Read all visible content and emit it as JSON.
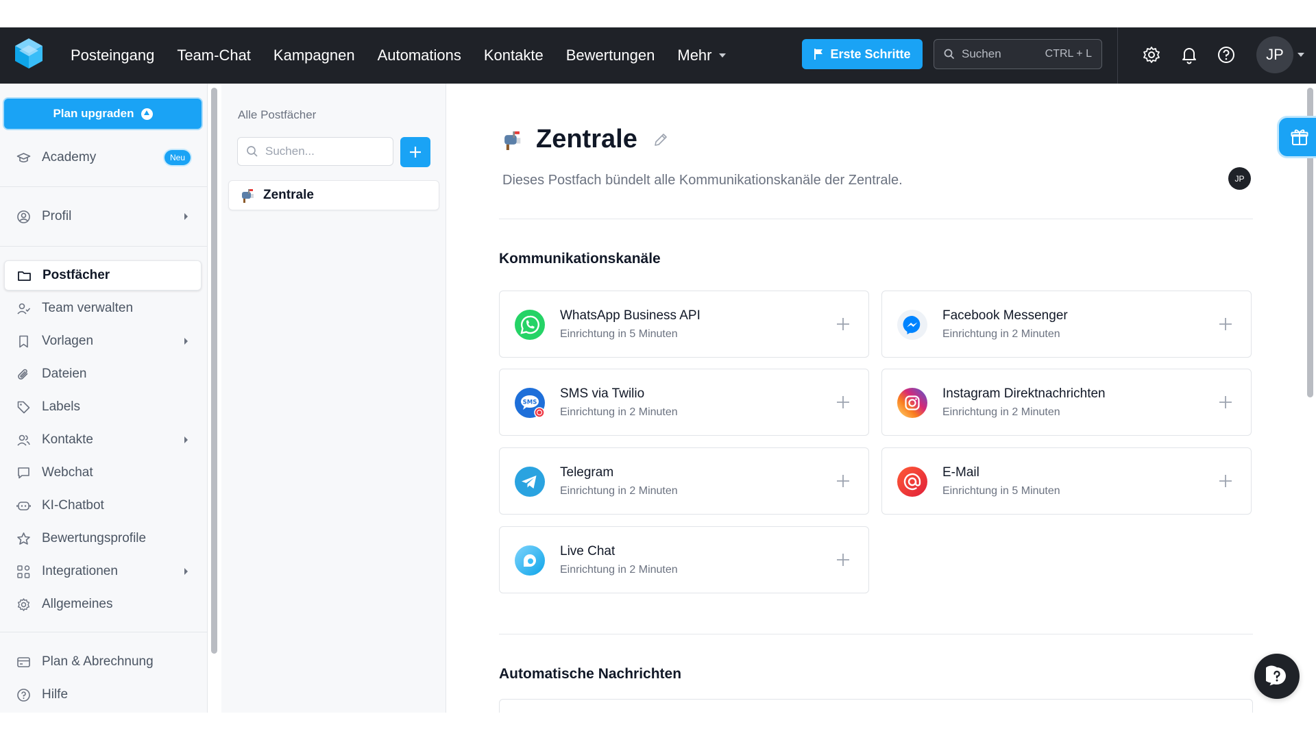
{
  "navbar": {
    "links": [
      "Posteingang",
      "Team-Chat",
      "Kampagnen",
      "Automations",
      "Kontakte",
      "Bewertungen"
    ],
    "more_label": "Mehr",
    "first_steps_label": "Erste Schritte",
    "search_placeholder": "Suchen",
    "search_shortcut": "CTRL + L",
    "avatar_initials": "JP",
    "icons": [
      "settings-icon",
      "bell-icon",
      "help-icon"
    ]
  },
  "sidebar": {
    "upgrade_label": "Plan upgraden",
    "items": [
      {
        "label": "Academy",
        "icon": "graduation-cap-icon",
        "badge": "Neu"
      },
      {
        "label": "Profil",
        "icon": "user-circle-icon",
        "has_submenu": true
      },
      {
        "label": "Postfächer",
        "icon": "folder-icon",
        "active": true
      },
      {
        "label": "Team verwalten",
        "icon": "user-check-icon"
      },
      {
        "label": "Vorlagen",
        "icon": "bookmark-icon",
        "has_submenu": true
      },
      {
        "label": "Dateien",
        "icon": "paperclip-icon"
      },
      {
        "label": "Labels",
        "icon": "tag-icon"
      },
      {
        "label": "Kontakte",
        "icon": "users-icon",
        "has_submenu": true
      },
      {
        "label": "Webchat",
        "icon": "chat-bubble-icon"
      },
      {
        "label": "KI-Chatbot",
        "icon": "bot-icon"
      },
      {
        "label": "Bewertungsprofile",
        "icon": "star-icon"
      },
      {
        "label": "Integrationen",
        "icon": "integrations-icon",
        "has_submenu": true
      },
      {
        "label": "Allgemeines",
        "icon": "gear-icon"
      },
      {
        "label": "Plan & Abrechnung",
        "icon": "credit-card-icon"
      },
      {
        "label": "Hilfe",
        "icon": "help-circle-icon"
      }
    ]
  },
  "mailboxes": {
    "title": "Alle Postfächer",
    "search_placeholder": "Suchen...",
    "items": [
      {
        "label": "Zentrale",
        "icon": "mailbox-icon"
      }
    ]
  },
  "main": {
    "title": "Zentrale",
    "description": "Dieses Postfach bündelt alle Kommunikationskanäle der Zentrale.",
    "owner_initials": "JP",
    "channels_title": "Kommunikationskanäle",
    "channels": [
      {
        "name": "WhatsApp Business API",
        "setup": "Einrichtung in 5 Minuten",
        "icon": "whatsapp-icon",
        "color": "#25d366"
      },
      {
        "name": "Facebook Messenger",
        "setup": "Einrichtung in 2 Minuten",
        "icon": "messenger-icon",
        "color": "#0084ff"
      },
      {
        "name": "SMS via Twilio",
        "setup": "Einrichtung in 2 Minuten",
        "icon": "sms-icon",
        "color": "#1e6fd9"
      },
      {
        "name": "Instagram Direktnachrichten",
        "setup": "Einrichtung in 2 Minuten",
        "icon": "instagram-icon",
        "color": "#dd2a7b"
      },
      {
        "name": "Telegram",
        "setup": "Einrichtung in 2 Minuten",
        "icon": "telegram-icon",
        "color": "#2aa3e0"
      },
      {
        "name": "E-Mail",
        "setup": "Einrichtung in 5 Minuten",
        "icon": "email-at-icon",
        "color": "#f04030"
      },
      {
        "name": "Live Chat",
        "setup": "Einrichtung in 2 Minuten",
        "icon": "live-chat-icon",
        "color": "#38bdf8"
      }
    ],
    "auto_messages_title": "Automatische Nachrichten"
  },
  "colors": {
    "accent": "#1aa3f5",
    "navbar_bg": "#1f2228",
    "sidebar_bg": "#f7f8fa"
  }
}
